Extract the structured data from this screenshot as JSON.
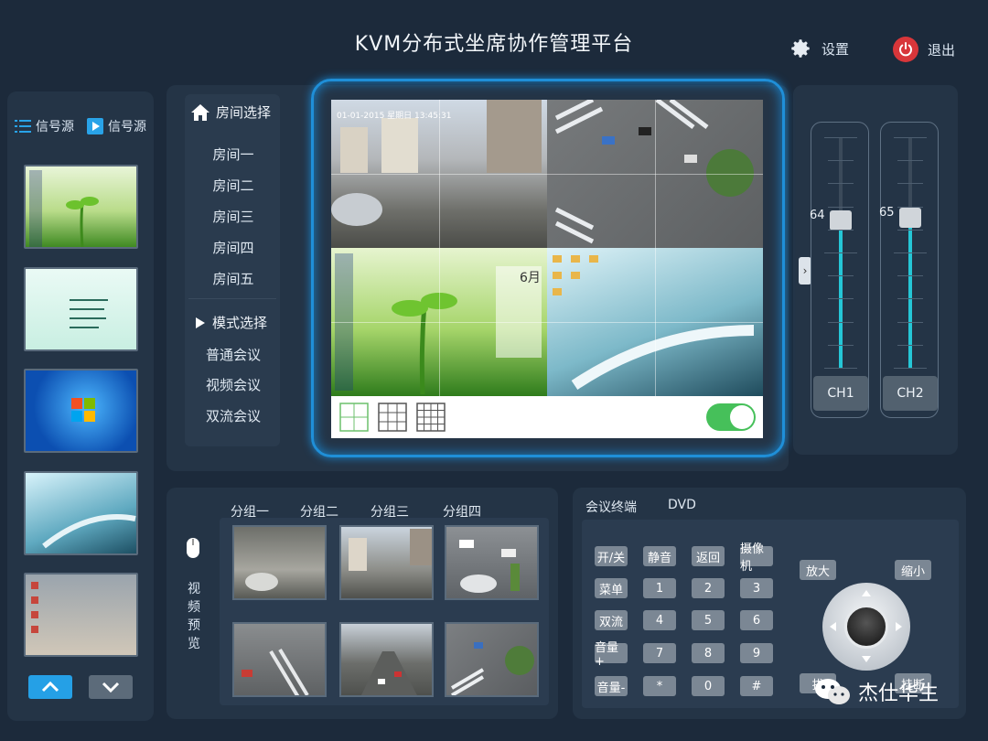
{
  "app": {
    "title": "KVM分布式坐席协作管理平台"
  },
  "top": {
    "settings": "设置",
    "exit": "退出"
  },
  "sources": {
    "tab1": "信号源",
    "tab2": "信号源"
  },
  "rooms": {
    "header": "房间选择",
    "items": [
      "房间一",
      "房间二",
      "房间三",
      "房间四",
      "房间五"
    ]
  },
  "modes": {
    "header": "模式选择",
    "items": [
      "普通会议",
      "视频会议",
      "双流会议"
    ]
  },
  "wall": {
    "timestamp": "01-01-2015 星期日 13:45:31",
    "calendar": "6月"
  },
  "sliders": [
    {
      "value": 64,
      "label": "CH1",
      "level": 0.64
    },
    {
      "value": 65,
      "label": "CH2",
      "level": 0.65
    }
  ],
  "groups": {
    "tabs": [
      "分组一",
      "分组二",
      "分组三",
      "分组四"
    ],
    "preview_label": "视频预览"
  },
  "terminal": {
    "tabs": [
      "会议终端",
      "DVD"
    ],
    "rows": [
      [
        "开/关",
        "静音",
        "返回",
        "摄像机"
      ],
      [
        "菜单",
        "1",
        "2",
        "3"
      ],
      [
        "双流",
        "4",
        "5",
        "6"
      ],
      [
        "音量+",
        "7",
        "8",
        "9"
      ],
      [
        "音量-",
        "*",
        "0",
        "#"
      ]
    ],
    "zoom_in": "放大",
    "zoom_out": "缩小",
    "btn_bl": "拔",
    "btn_br": "挂断"
  },
  "watermark": {
    "text": "杰仕华生"
  },
  "colors": {
    "accent": "#1f8fd8",
    "toggle_on": "#46c05a",
    "power": "#d8363a",
    "slider_fill": "#25c6d6"
  }
}
